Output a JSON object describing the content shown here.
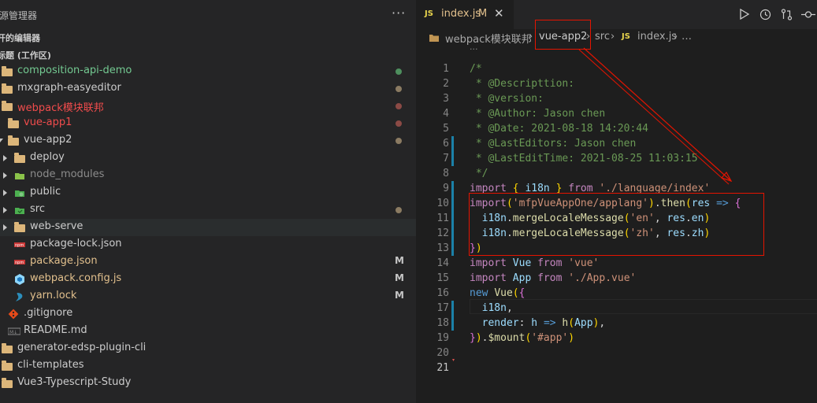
{
  "explorer": {
    "title": "源管理器",
    "more": "···",
    "open_editors_label": "开的编辑器",
    "workspace_label": "标题 (工作区)",
    "tree": [
      {
        "label": "composition-api-demo",
        "color": "#73c991",
        "dot": "#4e8f5e",
        "kind": "workspace"
      },
      {
        "label": "mxgraph-easyeditor",
        "color": "#cccccc",
        "dot": "#8b7b62",
        "kind": "workspace"
      },
      {
        "label": "webpack模块联邦",
        "color": "#f14c4c",
        "dot": "#8b4a45",
        "kind": "workspace"
      },
      {
        "label": "vue-app1",
        "color": "#f14c4c",
        "dot": "#8b4a45",
        "kind": "folder"
      },
      {
        "label": "vue-app2",
        "color": "#cccccc",
        "dot": "#8b7b62",
        "kind": "folder"
      },
      {
        "label": "deploy",
        "color": "#cccccc",
        "kind": "folder"
      },
      {
        "label": "node_modules",
        "color": "#8c8c8c",
        "kind": "node-folder"
      },
      {
        "label": "public",
        "color": "#cccccc",
        "kind": "public-folder"
      },
      {
        "label": "src",
        "color": "#cccccc",
        "dot": "#8b7b62",
        "kind": "src-folder"
      },
      {
        "label": "web-serve",
        "color": "#cccccc",
        "kind": "folder"
      },
      {
        "label": "package-lock.json",
        "color": "#cccccc",
        "kind": "npm-file"
      },
      {
        "label": "package.json",
        "color": "#e2c08d",
        "badge": "M",
        "kind": "npm-file"
      },
      {
        "label": "webpack.config.js",
        "color": "#e2c08d",
        "badge": "M",
        "kind": "webpack-file"
      },
      {
        "label": "yarn.lock",
        "color": "#e2c08d",
        "badge": "M",
        "kind": "yarn-file"
      },
      {
        "label": ".gitignore",
        "color": "#cccccc",
        "kind": "git-file"
      },
      {
        "label": "README.md",
        "color": "#cccccc",
        "kind": "md-file"
      },
      {
        "label": "generator-edsp-plugin-cli",
        "color": "#cccccc",
        "kind": "workspace"
      },
      {
        "label": "cli-templates",
        "color": "#cccccc",
        "kind": "workspace"
      },
      {
        "label": "Vue3-Typescript-Study",
        "color": "#cccccc",
        "kind": "workspace"
      }
    ]
  },
  "tab": {
    "icon": "JS",
    "name": "index.js",
    "modified": "M",
    "close": "✕"
  },
  "tab_actions": [
    "run-icon",
    "timeline-icon",
    "git-compare-icon",
    "source-control-icon"
  ],
  "breadcrumb": {
    "items": [
      "webpack模块联邦",
      "vue-app2",
      "src",
      "index.js"
    ],
    "separator": "›",
    "file_icon": "JS",
    "tail": "…",
    "folded": "···"
  },
  "code_lines": [
    {
      "n": "1",
      "g": "",
      "t": [
        [
          "c-com",
          "/*"
        ]
      ]
    },
    {
      "n": "2",
      "g": "",
      "t": [
        [
          "c-com",
          " * @Descripttion:"
        ]
      ]
    },
    {
      "n": "3",
      "g": "",
      "t": [
        [
          "c-com",
          " * @version:"
        ]
      ]
    },
    {
      "n": "4",
      "g": "",
      "t": [
        [
          "c-com",
          " * @Author: Jason chen"
        ]
      ]
    },
    {
      "n": "5",
      "g": "",
      "t": [
        [
          "c-com",
          " * @Date: 2021-08-18 14:20:44"
        ]
      ]
    },
    {
      "n": "6",
      "g": "#1b81a8",
      "t": [
        [
          "c-com",
          " * @LastEditors: Jason chen"
        ]
      ]
    },
    {
      "n": "7",
      "g": "#1b81a8",
      "t": [
        [
          "c-com",
          " * @LastEditTime: 2021-08-25 11:03:15"
        ]
      ]
    },
    {
      "n": "8",
      "g": "",
      "t": [
        [
          "c-com",
          " */"
        ]
      ]
    },
    {
      "n": "9",
      "g": "#1b81a8",
      "t": [
        [
          "c-kw",
          "import"
        ],
        [
          "c-pl",
          " "
        ],
        [
          "c-br1",
          "{"
        ],
        [
          "c-pl",
          " "
        ],
        [
          "c-var",
          "i18n"
        ],
        [
          "c-pl",
          " "
        ],
        [
          "c-br1",
          "}"
        ],
        [
          "c-pl",
          " "
        ],
        [
          "c-kw",
          "from"
        ],
        [
          "c-pl",
          " "
        ],
        [
          "c-str",
          "'./language/index'"
        ]
      ]
    },
    {
      "n": "10",
      "g": "#1b81a8",
      "t": [
        [
          "c-kw",
          "import"
        ],
        [
          "c-br1",
          "("
        ],
        [
          "c-str",
          "'mfpVueAppOne/applang'"
        ],
        [
          "c-br1",
          ")"
        ],
        [
          "c-pl",
          "."
        ],
        [
          "c-fn",
          "then"
        ],
        [
          "c-br1",
          "("
        ],
        [
          "c-var",
          "res"
        ],
        [
          "c-pl",
          " "
        ],
        [
          "c-blue",
          "=>"
        ],
        [
          "c-pl",
          " "
        ],
        [
          "c-br2",
          "{"
        ]
      ]
    },
    {
      "n": "11",
      "g": "#1b81a8",
      "t": [
        [
          "c-pl",
          "  "
        ],
        [
          "c-var",
          "i18n"
        ],
        [
          "c-pl",
          "."
        ],
        [
          "c-fn",
          "mergeLocaleMessage"
        ],
        [
          "c-br1",
          "("
        ],
        [
          "c-str",
          "'en'"
        ],
        [
          "c-pl",
          ", "
        ],
        [
          "c-var",
          "res"
        ],
        [
          "c-pl",
          "."
        ],
        [
          "c-var",
          "en"
        ],
        [
          "c-br1",
          ")"
        ]
      ]
    },
    {
      "n": "12",
      "g": "#1b81a8",
      "t": [
        [
          "c-pl",
          "  "
        ],
        [
          "c-var",
          "i18n"
        ],
        [
          "c-pl",
          "."
        ],
        [
          "c-fn",
          "mergeLocaleMessage"
        ],
        [
          "c-br1",
          "("
        ],
        [
          "c-str",
          "'zh'"
        ],
        [
          "c-pl",
          ", "
        ],
        [
          "c-var",
          "res"
        ],
        [
          "c-pl",
          "."
        ],
        [
          "c-var",
          "zh"
        ],
        [
          "c-br1",
          ")"
        ]
      ]
    },
    {
      "n": "13",
      "g": "#1b81a8",
      "t": [
        [
          "c-br2",
          "}"
        ],
        [
          "c-br1",
          ")"
        ]
      ]
    },
    {
      "n": "14",
      "g": "",
      "t": [
        [
          "c-kw",
          "import"
        ],
        [
          "c-pl",
          " "
        ],
        [
          "c-var",
          "Vue"
        ],
        [
          "c-pl",
          " "
        ],
        [
          "c-kw",
          "from"
        ],
        [
          "c-pl",
          " "
        ],
        [
          "c-str",
          "'vue'"
        ]
      ]
    },
    {
      "n": "15",
      "g": "",
      "t": [
        [
          "c-kw",
          "import"
        ],
        [
          "c-pl",
          " "
        ],
        [
          "c-var",
          "App"
        ],
        [
          "c-pl",
          " "
        ],
        [
          "c-kw",
          "from"
        ],
        [
          "c-pl",
          " "
        ],
        [
          "c-str",
          "'./App.vue'"
        ]
      ]
    },
    {
      "n": "16",
      "g": "",
      "t": [
        [
          "c-blue",
          "new"
        ],
        [
          "c-pl",
          " "
        ],
        [
          "c-fn",
          "Vue"
        ],
        [
          "c-br1",
          "("
        ],
        [
          "c-br2",
          "{"
        ]
      ]
    },
    {
      "n": "17",
      "g": "#1b81a8",
      "t": [
        [
          "c-pl",
          "  "
        ],
        [
          "c-var",
          "i18n"
        ],
        [
          "c-pl",
          ","
        ]
      ]
    },
    {
      "n": "18",
      "g": "#1b81a8",
      "t": [
        [
          "c-pl",
          "  "
        ],
        [
          "c-var",
          "render"
        ],
        [
          "c-pl",
          ": "
        ],
        [
          "c-var",
          "h"
        ],
        [
          "c-pl",
          " "
        ],
        [
          "c-blue",
          "=>"
        ],
        [
          "c-pl",
          " "
        ],
        [
          "c-fn",
          "h"
        ],
        [
          "c-br1",
          "("
        ],
        [
          "c-var",
          "App"
        ],
        [
          "c-br1",
          ")"
        ],
        [
          "c-pl",
          ","
        ]
      ]
    },
    {
      "n": "19",
      "g": "",
      "t": [
        [
          "c-br2",
          "}"
        ],
        [
          "c-br1",
          ")"
        ],
        [
          "c-pl",
          "."
        ],
        [
          "c-fn",
          "$mount"
        ],
        [
          "c-br1",
          "("
        ],
        [
          "c-str",
          "'#app'"
        ],
        [
          "c-br1",
          ")"
        ]
      ]
    },
    {
      "n": "20",
      "g": "",
      "t": []
    },
    {
      "n": "21",
      "g": "",
      "t": [],
      "current": true
    }
  ]
}
